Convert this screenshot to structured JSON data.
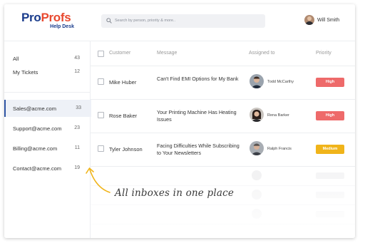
{
  "brand": {
    "name_part1": "Pro",
    "name_part2": "Profs",
    "subtitle": "Help Desk",
    "color_primary": "#1a3c8c",
    "color_accent": "#e8492f"
  },
  "search": {
    "placeholder": "Search by person, priority & more..",
    "icon": "search-icon"
  },
  "user": {
    "name": "Will Smith"
  },
  "sidebar": {
    "views": [
      {
        "label": "All",
        "count": "43"
      },
      {
        "label": "My Tickets",
        "count": "12"
      }
    ],
    "inboxes": [
      {
        "label": "Sales@acme.com",
        "count": "33",
        "active": true
      },
      {
        "label": "Support@acme.com",
        "count": "23",
        "active": false
      },
      {
        "label": "Billing@acme.com",
        "count": "11",
        "active": false
      },
      {
        "label": "Contact@acme.com",
        "count": "19",
        "active": false
      }
    ]
  },
  "table": {
    "columns": [
      "Customer",
      "Message",
      "Assigned to",
      "Priority"
    ],
    "rows": [
      {
        "customer": "Mike Huber",
        "message": "Can't Find EMI Options for My Bank",
        "agent": "Todd McCarthy",
        "priority": "High",
        "priority_color": "#ee6a6a"
      },
      {
        "customer": "Rose Baker",
        "message": "Your Printing Machine Has Heating Issues",
        "agent": "Rena Barker",
        "priority": "High",
        "priority_color": "#ee6a6a"
      },
      {
        "customer": "Tyler Johnson",
        "message": "Facing Difficulties While Subscribing to Your Newsletters",
        "agent": "Ralph Francis",
        "priority": "Medium",
        "priority_color": "#f0b41a"
      }
    ]
  },
  "annotation": {
    "text": "All inboxes in one place",
    "arrow_color": "#f0b41a"
  }
}
